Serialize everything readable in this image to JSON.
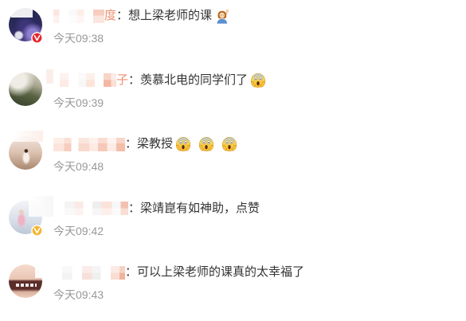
{
  "colors": {
    "username": "#eb7350",
    "comment_text": "#333333",
    "timestamp": "#999999",
    "badge_red": "#e8232b",
    "badge_gold": "#f7b52c"
  },
  "comments": [
    {
      "username_fragment": "度",
      "separator": "：",
      "text": "想上梁老师的课",
      "emojis": [
        "person-raising-hand-emoji-icon"
      ],
      "timestamp": "今天09:38",
      "badge": "verified-red-badge-icon"
    },
    {
      "username_fragment": "子",
      "separator": "：",
      "text": "羡慕北电的同学们了",
      "emojis": [
        "face-screaming-in-fear-emoji-icon"
      ],
      "timestamp": "今天09:39"
    },
    {
      "separator": "：",
      "text": "梁教授",
      "emojis": [
        "face-screaming-in-fear-emoji-icon",
        "face-screaming-in-fear-emoji-icon",
        "face-screaming-in-fear-emoji-icon"
      ],
      "timestamp": "今天09:48"
    },
    {
      "separator": "：",
      "text": "梁靖崑有如神助，点赞",
      "emojis": [],
      "timestamp": "今天09:42",
      "badge": "verified-gold-badge-icon"
    },
    {
      "separator": "：",
      "text": "可以上梁老师的课真的太幸福了",
      "emojis": [],
      "timestamp": "今天09:43"
    }
  ]
}
